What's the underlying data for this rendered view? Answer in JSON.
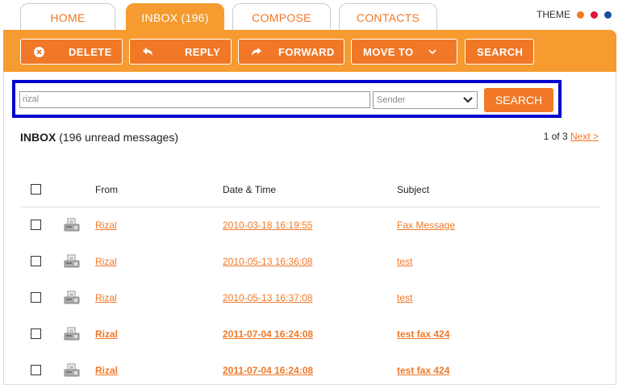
{
  "tabs": [
    {
      "label": "HOME",
      "active": false
    },
    {
      "label": "INBOX (196)",
      "active": true
    },
    {
      "label": "COMPOSE",
      "active": false
    },
    {
      "label": "CONTACTS",
      "active": false
    }
  ],
  "theme": {
    "label": "THEME",
    "colors": [
      "#f07826",
      "#e0143c",
      "#1a4fa0"
    ]
  },
  "toolbar": {
    "delete_label": "DELETE",
    "reply_label": "REPLY",
    "forward_label": "FORWARD",
    "move_to_label": "MOVE TO",
    "search_label": "SEARCH"
  },
  "search": {
    "query_value": "rizal",
    "field_selected": "Sender",
    "button_label": "SEARCH"
  },
  "inbox": {
    "title": "INBOX",
    "unread": "(196 unread messages)",
    "page_info": "1 of 3",
    "next_label": "Next >"
  },
  "columns": {
    "from": "From",
    "datetime": "Date & Time",
    "subject": "Subject"
  },
  "messages": [
    {
      "from": "Rizal",
      "datetime": "2010-03-18 16:19:55",
      "subject": "Fax Message",
      "unread": false
    },
    {
      "from": "Rizal",
      "datetime": "2010-05-13 16:36:08",
      "subject": "test",
      "unread": false
    },
    {
      "from": "Rizal",
      "datetime": "2010-05-13 16:37:08",
      "subject": "test",
      "unread": false
    },
    {
      "from": "Rizal",
      "datetime": "2011-07-04 16:24:08",
      "subject": "test fax 424",
      "unread": true
    },
    {
      "from": "Rizal",
      "datetime": "2011-07-04 16:24:08",
      "subject": "test fax 424",
      "unread": true
    }
  ],
  "colors": {
    "accent": "#f07826",
    "toolbar_bg": "#f59b2f",
    "highlight_border": "#0000cc"
  },
  "icons": {
    "delete": "close-circle-icon",
    "reply": "reply-arrow-icon",
    "forward": "forward-arrow-icon",
    "move_to": "chevron-down-icon",
    "message_row": "fax-machine-icon"
  }
}
